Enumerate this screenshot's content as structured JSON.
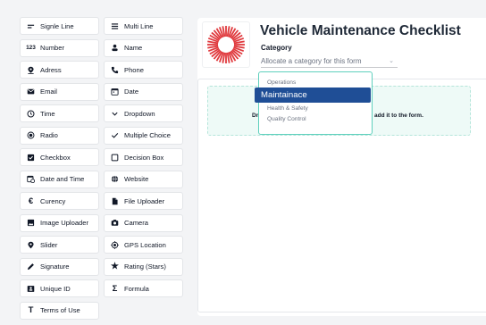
{
  "palette": {
    "items": [
      {
        "label": "Signle Line",
        "icon": "short-text-icon"
      },
      {
        "label": "Multi Line",
        "icon": "long-text-icon"
      },
      {
        "label": "Number",
        "icon": "number-icon",
        "glyph": "123"
      },
      {
        "label": "Name",
        "icon": "person-icon"
      },
      {
        "label": "Adress",
        "icon": "location-pin-icon"
      },
      {
        "label": "Phone",
        "icon": "phone-icon"
      },
      {
        "label": "Email",
        "icon": "email-icon"
      },
      {
        "label": "Date",
        "icon": "calendar-icon"
      },
      {
        "label": "Time",
        "icon": "clock-icon"
      },
      {
        "label": "Dropdown",
        "icon": "chevron-down-icon"
      },
      {
        "label": "Radio",
        "icon": "radio-icon"
      },
      {
        "label": "Multiple Choice",
        "icon": "check-icon"
      },
      {
        "label": "Checkbox",
        "icon": "checkbox-icon"
      },
      {
        "label": "Decision Box",
        "icon": "empty-box-icon"
      },
      {
        "label": "Date and Time",
        "icon": "calendar-clock-icon"
      },
      {
        "label": "Website",
        "icon": "globe-icon"
      },
      {
        "label": "Curency",
        "icon": "euro-icon",
        "glyph": "€"
      },
      {
        "label": "File Uploader",
        "icon": "file-icon"
      },
      {
        "label": "Image Uploader",
        "icon": "image-icon"
      },
      {
        "label": "Camera",
        "icon": "camera-icon"
      },
      {
        "label": "Slider",
        "icon": "slider-pin-icon"
      },
      {
        "label": "GPS Location",
        "icon": "gps-target-icon"
      },
      {
        "label": "Signature",
        "icon": "pen-icon"
      },
      {
        "label": "Rating (Stars)",
        "icon": "star-icon",
        "glyph": "★"
      },
      {
        "label": "Unique ID",
        "icon": "id-card-icon"
      },
      {
        "label": "Formula",
        "icon": "sigma-icon",
        "glyph": "Σ"
      },
      {
        "label": "Terms of Use",
        "icon": "text-t-icon",
        "glyph": "T"
      }
    ]
  },
  "form": {
    "title": "Vehicle Maintenance Checklist",
    "category_label": "Category",
    "category_placeholder": "Allocate a category for this form",
    "dropzone_text_left": "Dra",
    "dropzone_text_right": "add it to the form."
  },
  "category_dropdown": {
    "options": [
      "Operations",
      "Maintainace",
      "Health & Safety",
      "Quality Control"
    ],
    "selected": "Maintainace"
  },
  "colors": {
    "logo_red": "#e03a3e",
    "selected_bg": "#1f4e96",
    "dropzone_bg": "#eefaf7",
    "dropdown_border": "#5fd0bd"
  }
}
